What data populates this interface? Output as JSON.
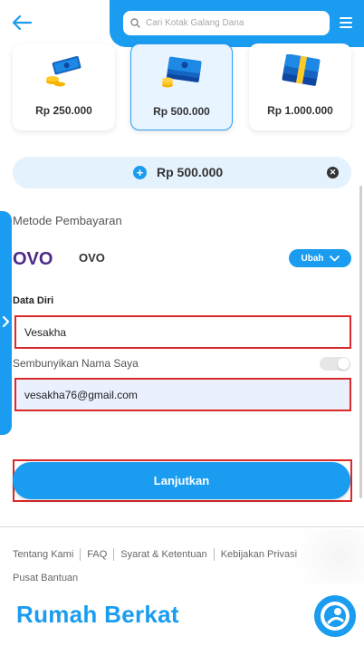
{
  "header": {
    "search_placeholder": "Cari Kotak Galang Dana"
  },
  "amounts": [
    {
      "label": "Rp 250.000",
      "selected": false
    },
    {
      "label": "Rp 500.000",
      "selected": true
    },
    {
      "label": "Rp 1.000.000",
      "selected": false
    }
  ],
  "selected_amount": "Rp 500.000",
  "payment": {
    "section_title": "Metode Pembayaran",
    "logo_text": "OVO",
    "method_name": "OVO",
    "change_label": "Ubah"
  },
  "personal": {
    "section_title": "Data Diri",
    "name_value": "Vesakha",
    "hide_name_label": "Sembunyikan Nama Saya",
    "hide_name_on": false,
    "email_value": "vesakha76@gmail.com"
  },
  "cta_label": "Lanjutkan",
  "footer": {
    "links": [
      "Tentang Kami",
      "FAQ",
      "Syarat & Ketentuan",
      "Kebijakan Privasi",
      "Pusat Bantuan"
    ],
    "brand": "Rumah Berkat"
  },
  "colors": {
    "primary": "#1a9cf0",
    "highlight_border": "#d92b2b",
    "ovo_purple": "#4c2a86"
  }
}
